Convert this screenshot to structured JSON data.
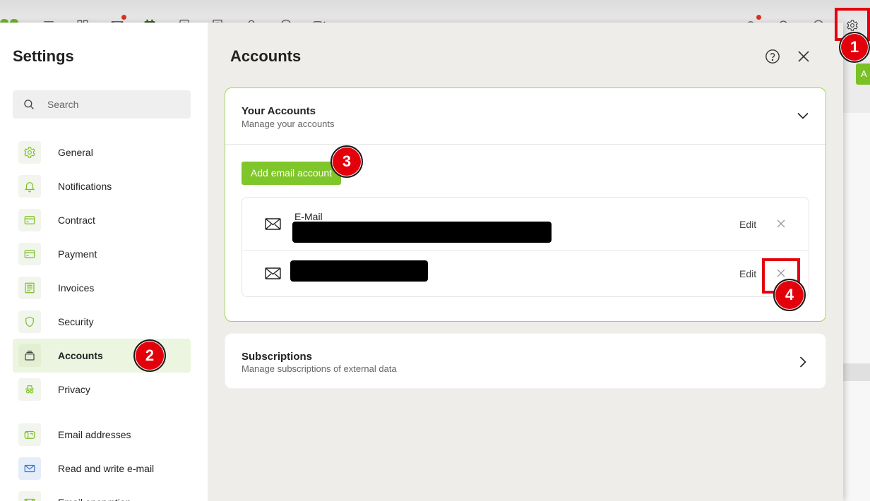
{
  "topbar": {
    "icons": [
      "app-logo",
      "menu-icon",
      "apps-icon",
      "mail-icon",
      "calendar-icon",
      "contacts-icon",
      "notes-icon",
      "user-icon",
      "chat-icon",
      "video-icon",
      "notifications-icon",
      "search-icon",
      "help-icon",
      "settings-gear-icon"
    ],
    "partial_button_label": "A"
  },
  "annotations": {
    "step_1": "1",
    "step_2": "2",
    "step_3": "3",
    "step_4": "4"
  },
  "settings": {
    "title": "Settings",
    "search": {
      "placeholder": "Search",
      "value": ""
    },
    "menu": [
      {
        "label": "General",
        "icon": "gear-icon"
      },
      {
        "label": "Notifications",
        "icon": "bell-icon"
      },
      {
        "label": "Contract",
        "icon": "card-icon"
      },
      {
        "label": "Payment",
        "icon": "credit-card-icon"
      },
      {
        "label": "Invoices",
        "icon": "invoice-icon"
      },
      {
        "label": "Security",
        "icon": "shield-icon"
      },
      {
        "label": "Accounts",
        "icon": "stack-icon",
        "active": true
      },
      {
        "label": "Privacy",
        "icon": "incognito-icon"
      },
      {
        "label": "Email addresses",
        "icon": "mailbox-icon"
      },
      {
        "label": "Read and write e-mail",
        "icon": "envelope-icon"
      },
      {
        "label": "Email encryption",
        "icon": "encryption-icon"
      }
    ]
  },
  "accounts_panel": {
    "title": "Accounts",
    "your_accounts": {
      "title": "Your Accounts",
      "subtitle": "Manage your accounts",
      "add_button_label": "Add email account",
      "expanded": true,
      "accounts": [
        {
          "type_label": "E-Mail",
          "edit_label": "Edit",
          "address_redacted": true
        },
        {
          "edit_label": "Edit",
          "address_redacted": true
        }
      ]
    },
    "subscriptions": {
      "title": "Subscriptions",
      "subtitle": "Manage subscriptions of external data"
    }
  },
  "colors": {
    "brand_green": "#7fc62a",
    "card_border_green": "#9cd45c",
    "active_row_bg": "#ebf5e0",
    "annotation_red": "#e3000b",
    "panel_bg": "#efede9"
  }
}
